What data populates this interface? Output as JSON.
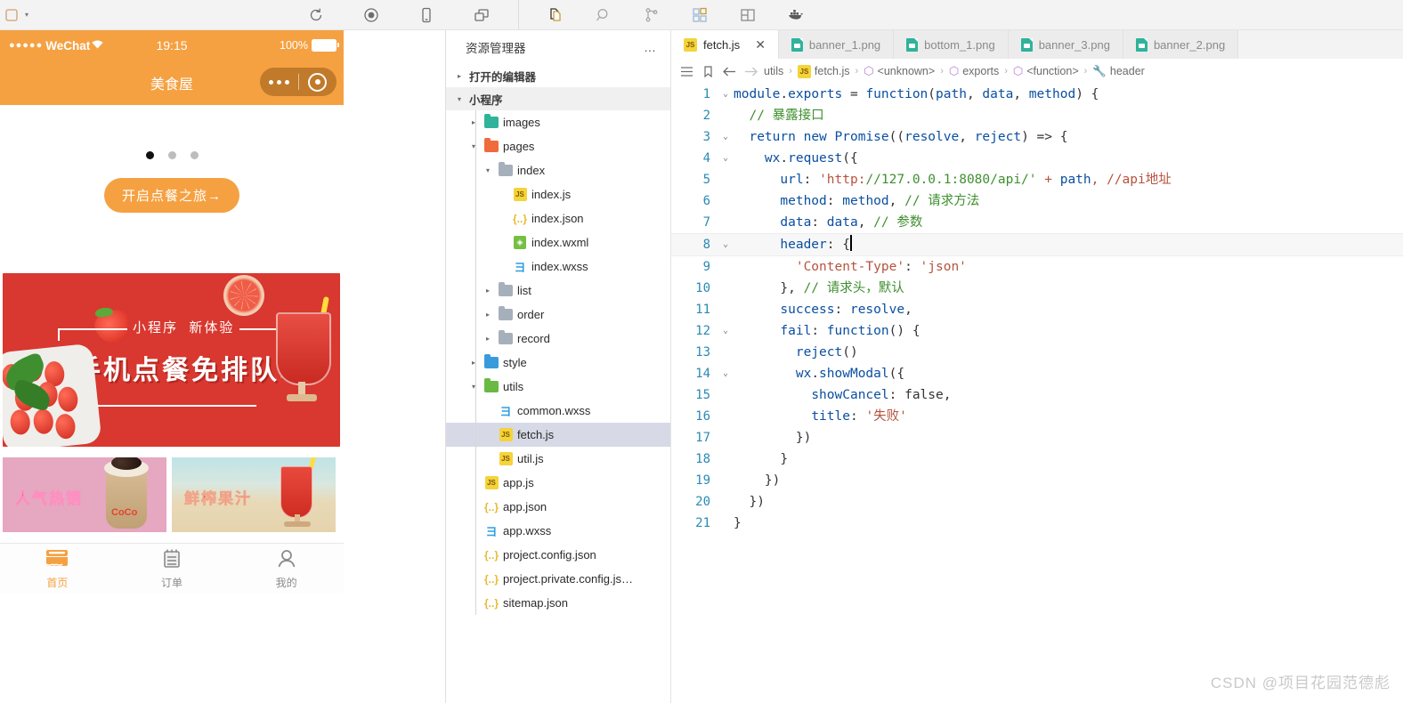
{
  "toolbar": {
    "left_caret": "▾",
    "icons": [
      {
        "name": "refresh-icon",
        "title": "编译"
      },
      {
        "name": "record-icon",
        "title": "真机调试"
      },
      {
        "name": "phone-preview-icon",
        "title": "预览"
      },
      {
        "name": "window-switch-icon",
        "title": "切换"
      },
      {
        "name": "explorer-icon",
        "title": "资源管理器"
      },
      {
        "name": "search-icon",
        "title": "搜索"
      },
      {
        "name": "source-control-icon",
        "title": "源代码管理"
      },
      {
        "name": "extensions-icon",
        "title": "扩展"
      },
      {
        "name": "layout-icon",
        "title": "布局"
      },
      {
        "name": "docker-icon",
        "title": "Docker"
      }
    ]
  },
  "simulator": {
    "status": {
      "signal_dots": "●●●●●",
      "carrier": "WeChat",
      "wifi": "⌃",
      "time": "19:15",
      "battery_percent": "100%"
    },
    "nav_title": "美食屋",
    "capsule": {
      "dots": "•••",
      "circle": "◉"
    },
    "carousel_dots": [
      "active",
      "inactive",
      "inactive"
    ],
    "cta_label": "开启点餐之旅→",
    "banner": {
      "subtitle_left": "小程序",
      "subtitle_right": "新体验",
      "headline": "手机点餐免排队哦"
    },
    "cards": [
      {
        "label": "人气热销",
        "brand": "CoCo"
      },
      {
        "label": "鲜榨果汁",
        "brand": ""
      }
    ],
    "tabbar": [
      {
        "label": "首页",
        "icon": "shop-icon",
        "active": true
      },
      {
        "label": "订单",
        "icon": "order-list-icon",
        "active": false
      },
      {
        "label": "我的",
        "icon": "user-icon",
        "active": false
      }
    ]
  },
  "explorer": {
    "title": "资源管理器",
    "more_label": "…",
    "sections": [
      {
        "label": "打开的编辑器",
        "expanded": false
      },
      {
        "label": "小程序",
        "expanded": true
      }
    ],
    "tree": [
      {
        "label": "images",
        "type": "folder-img",
        "depth": 1,
        "twisty": "▸",
        "selected": false
      },
      {
        "label": "pages",
        "type": "folder-pages",
        "depth": 1,
        "twisty": "▾",
        "selected": false
      },
      {
        "label": "index",
        "type": "folder",
        "depth": 2,
        "twisty": "▾",
        "selected": false
      },
      {
        "label": "index.js",
        "type": "js",
        "depth": 3,
        "twisty": "",
        "selected": false
      },
      {
        "label": "index.json",
        "type": "json",
        "depth": 3,
        "twisty": "",
        "selected": false
      },
      {
        "label": "index.wxml",
        "type": "wxml",
        "depth": 3,
        "twisty": "",
        "selected": false
      },
      {
        "label": "index.wxss",
        "type": "wxss",
        "depth": 3,
        "twisty": "",
        "selected": false
      },
      {
        "label": "list",
        "type": "folder",
        "depth": 2,
        "twisty": "▸",
        "selected": false
      },
      {
        "label": "order",
        "type": "folder",
        "depth": 2,
        "twisty": "▸",
        "selected": false
      },
      {
        "label": "record",
        "type": "folder",
        "depth": 2,
        "twisty": "▸",
        "selected": false
      },
      {
        "label": "style",
        "type": "folder-style",
        "depth": 1,
        "twisty": "▸",
        "selected": false
      },
      {
        "label": "utils",
        "type": "folder-utils",
        "depth": 1,
        "twisty": "▾",
        "selected": false
      },
      {
        "label": "common.wxss",
        "type": "wxss",
        "depth": 2,
        "twisty": "",
        "selected": false
      },
      {
        "label": "fetch.js",
        "type": "js",
        "depth": 2,
        "twisty": "",
        "selected": true
      },
      {
        "label": "util.js",
        "type": "js",
        "depth": 2,
        "twisty": "",
        "selected": false
      },
      {
        "label": "app.js",
        "type": "js",
        "depth": 1,
        "twisty": "",
        "selected": false
      },
      {
        "label": "app.json",
        "type": "json",
        "depth": 1,
        "twisty": "",
        "selected": false
      },
      {
        "label": "app.wxss",
        "type": "wxss",
        "depth": 1,
        "twisty": "",
        "selected": false
      },
      {
        "label": "project.config.json",
        "type": "json",
        "depth": 1,
        "twisty": "",
        "selected": false
      },
      {
        "label": "project.private.config.js…",
        "type": "json",
        "depth": 1,
        "twisty": "",
        "selected": false
      },
      {
        "label": "sitemap.json",
        "type": "json",
        "depth": 1,
        "twisty": "",
        "selected": false
      }
    ]
  },
  "editor": {
    "tabs": [
      {
        "label": "fetch.js",
        "icon": "js-icon",
        "active": true,
        "close": "✕"
      },
      {
        "label": "banner_1.png",
        "icon": "png-icon",
        "active": false
      },
      {
        "label": "bottom_1.png",
        "icon": "png-icon",
        "active": false
      },
      {
        "label": "banner_3.png",
        "icon": "png-icon",
        "active": false
      },
      {
        "label": "banner_2.png",
        "icon": "png-icon",
        "active": false
      }
    ],
    "breadcrumb": {
      "icons": [
        "outline-icon",
        "bookmark-icon",
        "back-arrow-icon",
        "forward-arrow-icon"
      ],
      "items": [
        {
          "label": "utils",
          "icon": ""
        },
        {
          "label": "fetch.js",
          "icon": "js-icon"
        },
        {
          "label": "<unknown>",
          "icon": "symbol-icon"
        },
        {
          "label": "exports",
          "icon": "symbol-icon"
        },
        {
          "label": "<function>",
          "icon": "symbol-icon"
        },
        {
          "label": "header",
          "icon": "wrench-icon"
        }
      ],
      "separator": "›"
    },
    "lines": [
      {
        "n": "1",
        "fold": "⌄",
        "cur": false
      },
      {
        "n": "2",
        "fold": "",
        "cur": false
      },
      {
        "n": "3",
        "fold": "⌄",
        "cur": false
      },
      {
        "n": "4",
        "fold": "⌄",
        "cur": false
      },
      {
        "n": "5",
        "fold": "",
        "cur": false
      },
      {
        "n": "6",
        "fold": "",
        "cur": false
      },
      {
        "n": "7",
        "fold": "",
        "cur": false
      },
      {
        "n": "8",
        "fold": "⌄",
        "cur": true
      },
      {
        "n": "9",
        "fold": "",
        "cur": false
      },
      {
        "n": "10",
        "fold": "",
        "cur": false
      },
      {
        "n": "11",
        "fold": "",
        "cur": false
      },
      {
        "n": "12",
        "fold": "⌄",
        "cur": false
      },
      {
        "n": "13",
        "fold": "",
        "cur": false
      },
      {
        "n": "14",
        "fold": "⌄",
        "cur": false
      },
      {
        "n": "15",
        "fold": "",
        "cur": false
      },
      {
        "n": "16",
        "fold": "",
        "cur": false
      },
      {
        "n": "17",
        "fold": "",
        "cur": false
      },
      {
        "n": "18",
        "fold": "",
        "cur": false
      },
      {
        "n": "19",
        "fold": "",
        "cur": false
      },
      {
        "n": "20",
        "fold": "",
        "cur": false
      },
      {
        "n": "21",
        "fold": "",
        "cur": false
      }
    ],
    "source": [
      "module.exports = function(path, data, method) {",
      "  // 暴露接口",
      "  return new Promise((resolve, reject) => {",
      "    wx.request({",
      "      url: 'http://127.0.0.1:8080/api/' + path, //api地址",
      "      method: method, // 请求方法",
      "      data: data, // 参数",
      "      header: {",
      "        'Content-Type': 'json'",
      "      }, // 请求头，默认",
      "      success: resolve,",
      "      fail: function() {",
      "        reject()",
      "        wx.showModal({",
      "          showCancel: false,",
      "          title: '失败'",
      "        })",
      "      }",
      "    })",
      "  })",
      "}"
    ]
  },
  "watermark": "CSDN @项目花园范德彪"
}
